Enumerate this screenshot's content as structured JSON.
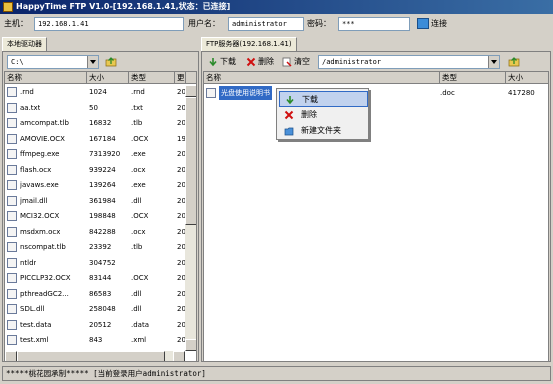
{
  "window": {
    "title": "HappyTime FTP V1.0-[192.168.1.41,状态：已连接]"
  },
  "connection": {
    "host_label": "主机：",
    "host_value": "192.168.1.41",
    "user_label": "用户名：",
    "user_value": "administrator",
    "pass_label": "密码：",
    "pass_value": "***",
    "connect_label": "连接"
  },
  "local": {
    "tab": "本地驱动器",
    "path": "C:\\",
    "columns": [
      "名称",
      "大小",
      "类型",
      "更"
    ],
    "files": [
      {
        "name": ".rnd",
        "size": "1024",
        "type": ".rnd",
        "date": "20"
      },
      {
        "name": "aa.txt",
        "size": "50",
        "type": ".txt",
        "date": "20"
      },
      {
        "name": "amcompat.tlb",
        "size": "16832",
        "type": ".tlb",
        "date": "20"
      },
      {
        "name": "AMOVIE.OCX",
        "size": "167184",
        "type": ".OCX",
        "date": "19"
      },
      {
        "name": "ffmpeg.exe",
        "size": "7313920",
        "type": ".exe",
        "date": "20"
      },
      {
        "name": "flash.ocx",
        "size": "939224",
        "type": ".ocx",
        "date": "20"
      },
      {
        "name": "javaws.exe",
        "size": "139264",
        "type": ".exe",
        "date": "20"
      },
      {
        "name": "jmail.dll",
        "size": "361984",
        "type": ".dll",
        "date": "20"
      },
      {
        "name": "MCI32.OCX",
        "size": "198848",
        "type": ".OCX",
        "date": "20"
      },
      {
        "name": "msdxm.ocx",
        "size": "842288",
        "type": ".ocx",
        "date": "20"
      },
      {
        "name": "nscompat.tlb",
        "size": "23392",
        "type": ".tlb",
        "date": "20"
      },
      {
        "name": "ntldr",
        "size": "304752",
        "type": "",
        "date": "20"
      },
      {
        "name": "PICCLP32.OCX",
        "size": "83144",
        "type": ".OCX",
        "date": "20"
      },
      {
        "name": "pthreadGC2...",
        "size": "86583",
        "type": ".dll",
        "date": "20"
      },
      {
        "name": "SDL.dll",
        "size": "258048",
        "type": ".dll",
        "date": "20"
      },
      {
        "name": "test.data",
        "size": "20512",
        "type": ".data",
        "date": "20"
      },
      {
        "name": "test.xml",
        "size": "843",
        "type": ".xml",
        "date": "20"
      }
    ]
  },
  "remote": {
    "tab": "FTP服务器(192.168.1.41)",
    "download": "下载",
    "delete": "删除",
    "clear": "清空",
    "path": "/administrator",
    "columns": [
      "名称",
      "类型",
      "大小"
    ],
    "files": [
      {
        "name": "光盘使用说明书",
        "type": ".doc",
        "size": "417280"
      }
    ]
  },
  "context_menu": {
    "items": [
      "下载",
      "删除",
      "新建文件夹"
    ]
  },
  "status": {
    "text": "*****桃花园承制***** [当前登录用户administrator]"
  }
}
